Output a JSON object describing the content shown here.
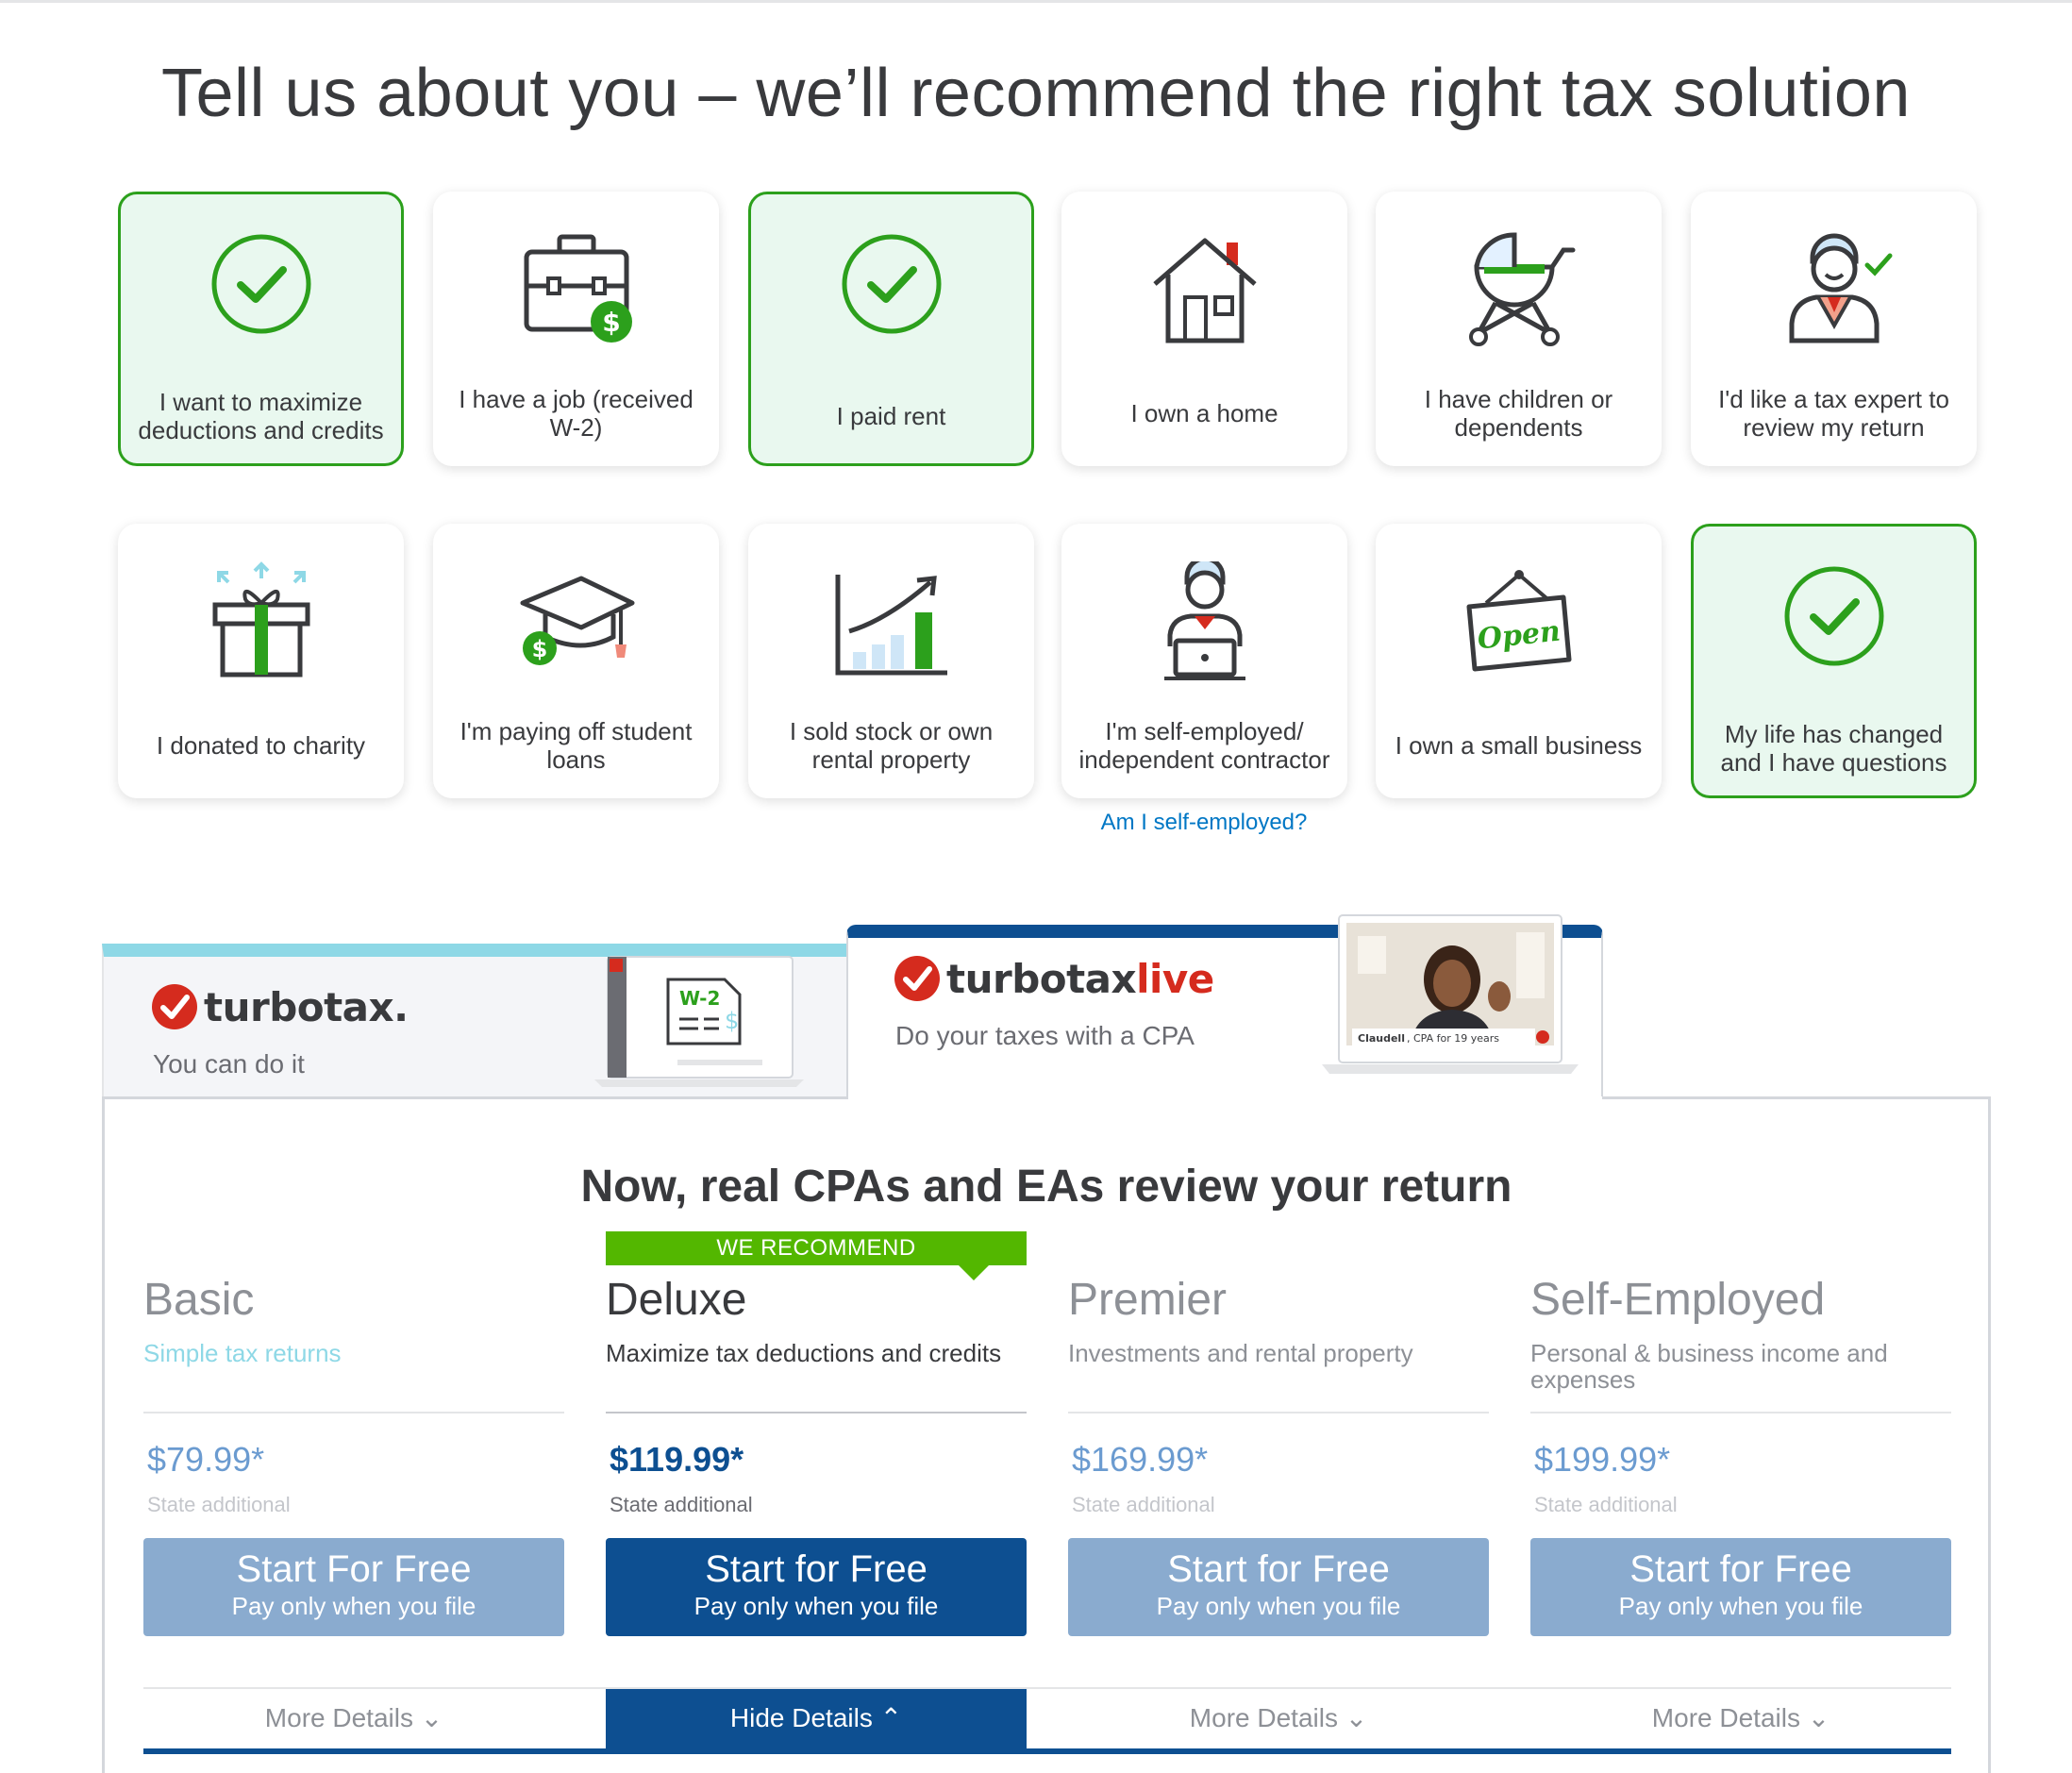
{
  "page_title": "Tell us about you – we’ll recommend the right tax solution",
  "situations": [
    {
      "label": "I want to maximize deductions and credits",
      "selected": true,
      "icon": "check-circle-icon"
    },
    {
      "label": "I have a job (received W-2)",
      "selected": false,
      "icon": "briefcase-dollar-icon"
    },
    {
      "label": "I paid rent",
      "selected": true,
      "icon": "check-circle-icon"
    },
    {
      "label": "I own a home",
      "selected": false,
      "icon": "house-icon"
    },
    {
      "label": "I have children or dependents",
      "selected": false,
      "icon": "stroller-icon"
    },
    {
      "label": "I'd like a tax expert to review my return",
      "selected": false,
      "icon": "tax-expert-icon"
    },
    {
      "label": "I donated to charity",
      "selected": false,
      "icon": "gift-icon"
    },
    {
      "label": "I'm paying off student loans",
      "selected": false,
      "icon": "graduation-cap-dollar-icon"
    },
    {
      "label": "I sold stock or own rental property",
      "selected": false,
      "icon": "rising-chart-icon"
    },
    {
      "label": "I'm self-employed/ independent contractor",
      "selected": false,
      "icon": "person-laptop-icon"
    },
    {
      "label": "I own a small business",
      "selected": false,
      "icon": "open-sign-icon"
    },
    {
      "label": "My life has changed and I have questions",
      "selected": true,
      "icon": "check-circle-icon"
    }
  ],
  "self_employed_link": "Am I self-employed?",
  "tabs": {
    "diy": {
      "brand": "turbotax",
      "brand_suffix": ".",
      "tagline": "You can do it",
      "illustration_text": "W-2"
    },
    "live": {
      "brand": "turbotax",
      "brand_live": "live",
      "tagline": "Do your taxes with a CPA",
      "video_caption_name": "Claudell",
      "video_caption_role": ", CPA for 19 years"
    }
  },
  "headline": "Now, real CPAs and EAs review your return",
  "recommend_badge": "WE RECOMMEND",
  "products": [
    {
      "name": "Basic",
      "desc": "Simple tax returns",
      "price": "$79.99*",
      "state": "State additional",
      "cta1": "Start For Free",
      "cta2": "Pay only when you file",
      "details": "More Details ⌄"
    },
    {
      "name": "Deluxe",
      "desc": "Maximize tax deductions and credits",
      "price": "$119.99*",
      "state": "State additional",
      "cta1": "Start for Free",
      "cta2": "Pay only when you file",
      "details": "Hide Details ⌃"
    },
    {
      "name": "Premier",
      "desc": "Investments and rental property",
      "price": "$169.99*",
      "state": "State additional",
      "cta1": "Start for Free",
      "cta2": "Pay only when you file",
      "details": "More Details ⌄"
    },
    {
      "name": "Self-Employed",
      "desc": "Personal & business income and expenses",
      "price": "$199.99*",
      "state": "State additional",
      "cta1": "Start for Free",
      "cta2": "Pay only when you file",
      "details": "More Details ⌄"
    }
  ],
  "colors": {
    "accent_green": "#2ca01c",
    "selected_bg": "#e9f8ef",
    "brand_blue": "#0d4f91",
    "live_red": "#d52b1e",
    "link_blue": "#0077c5"
  }
}
